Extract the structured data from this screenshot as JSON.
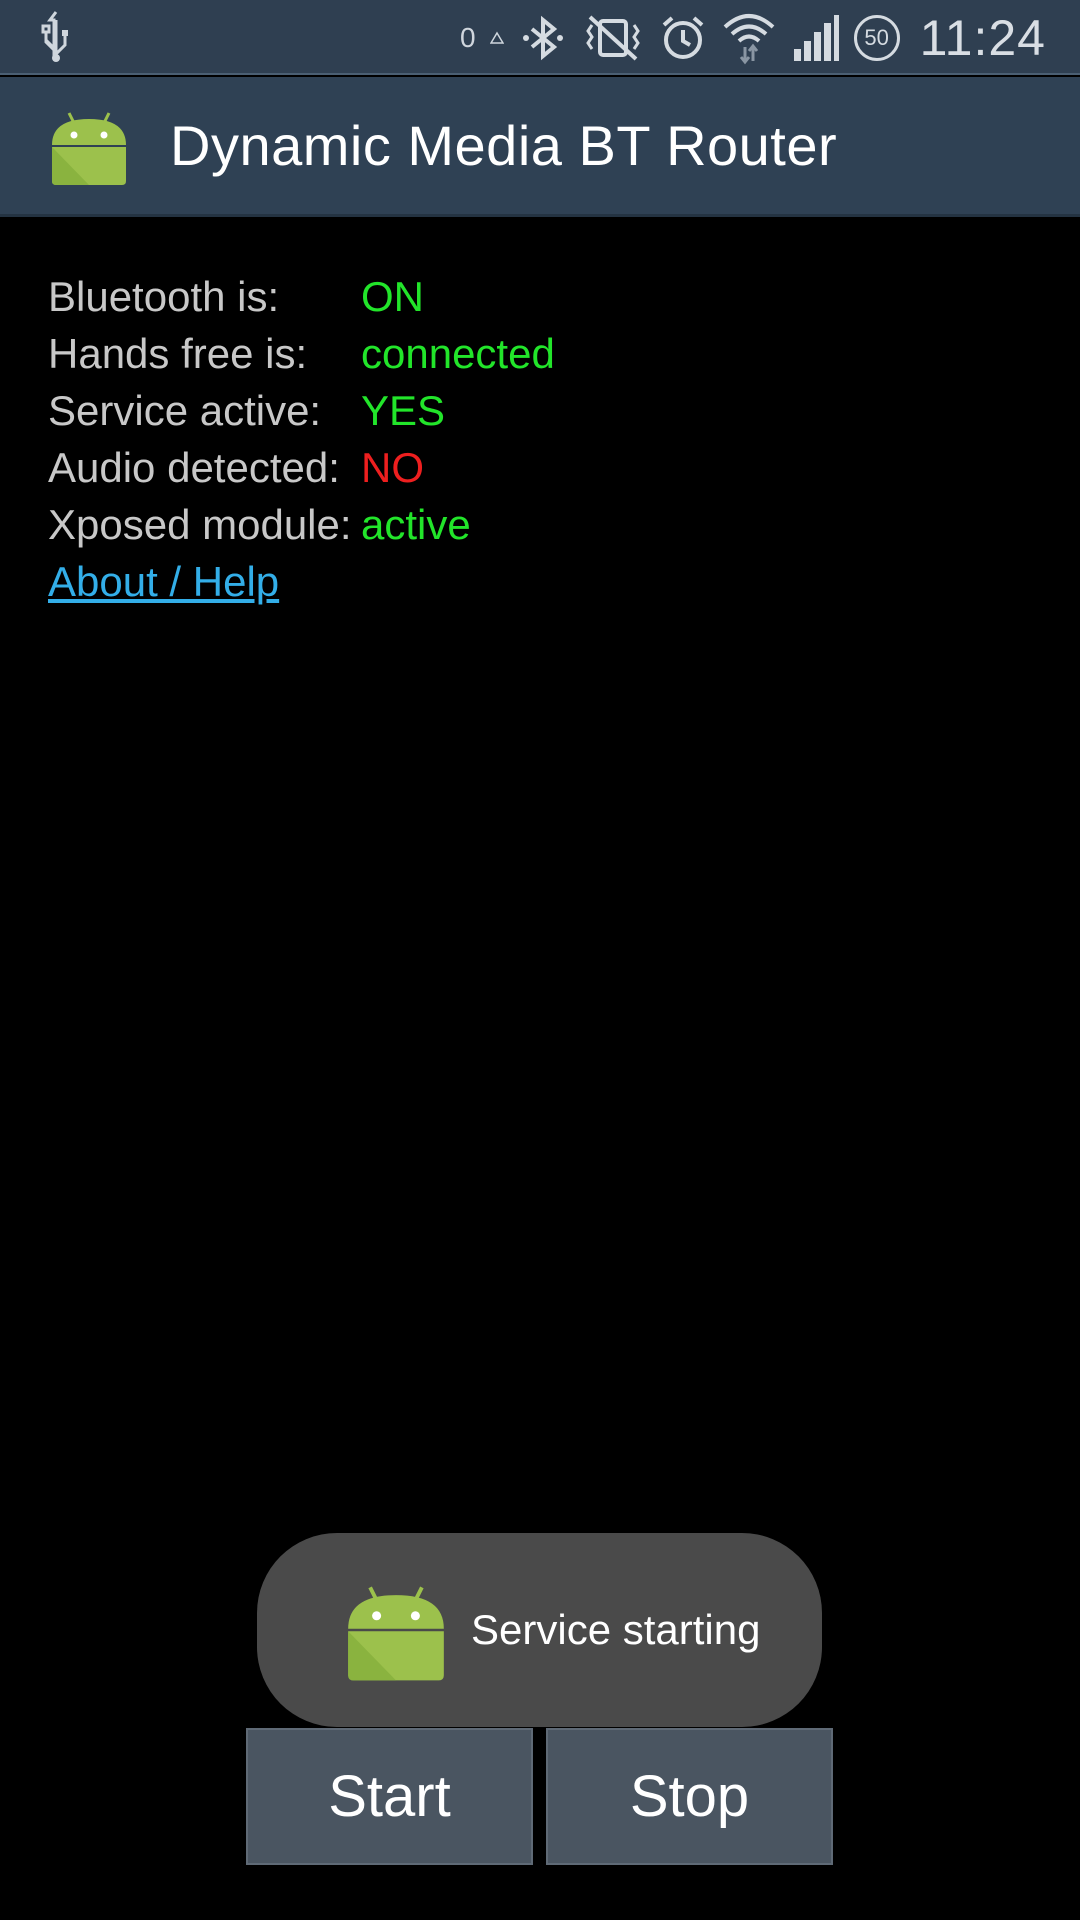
{
  "status_bar": {
    "icons": [
      "usb-icon",
      "bluetooth-icon",
      "vibrate-icon",
      "alarm-icon",
      "wifi-icon",
      "signal-icon",
      "battery-icon"
    ],
    "data_counter": "0",
    "battery_level": "50",
    "time": "11:24"
  },
  "app_bar": {
    "title": "Dynamic Media BT Router"
  },
  "status": {
    "rows": [
      {
        "label": "Bluetooth is:",
        "value": "ON",
        "state": "ok"
      },
      {
        "label": "Hands free is:",
        "value": "connected",
        "state": "ok"
      },
      {
        "label": "Service active:",
        "value": "YES",
        "state": "ok"
      },
      {
        "label": "Audio detected:",
        "value": "NO",
        "state": "bad"
      },
      {
        "label": "Xposed module:",
        "value": "active",
        "state": "ok"
      }
    ],
    "help_link": "About / Help"
  },
  "toast": {
    "message": "Service starting"
  },
  "buttons": {
    "start": "Start",
    "stop": "Stop"
  },
  "colors": {
    "ok": "#22e52a",
    "bad": "#ee1f1f",
    "link": "#33aee8",
    "app_bar": "#2f4154"
  }
}
